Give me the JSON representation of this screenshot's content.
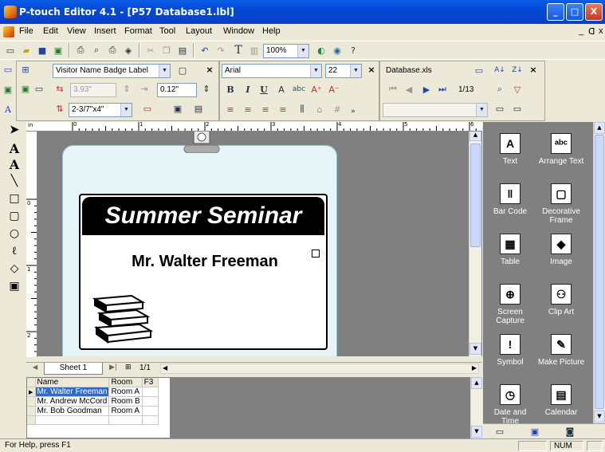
{
  "window": {
    "title": "P-touch Editor 4.1 - [P57 Database1.lbl]",
    "min": "_",
    "max": "□",
    "close": "X"
  },
  "menu": [
    "File",
    "Edit",
    "View",
    "Insert",
    "Format",
    "Tool",
    "Layout",
    "Window",
    "Help"
  ],
  "menu_right": {
    "minimize": "_",
    "restore": "ᗡ",
    "close": "x"
  },
  "toolbar": {
    "zoom": "100%"
  },
  "property_bar": {
    "label_type": "Visitor Name Badge Label",
    "width_value": "3.93\"",
    "margin_value": "0.12\"",
    "paper_size": "2-3/7\"x4\"",
    "font_name": "Arial",
    "font_size": "22",
    "database_file": "Database.xls",
    "record_counter": "1/13",
    "bold": "B",
    "italic": "I",
    "underline": "U"
  },
  "ruler": {
    "unit": "in",
    "ticks": [
      "0",
      "1",
      "2",
      "3",
      "4",
      "5",
      "6"
    ]
  },
  "label": {
    "title": "Summer Seminar",
    "name": "Mr. Walter Freeman"
  },
  "sheet": {
    "tab": "Sheet 1",
    "page": "1/1"
  },
  "database": {
    "columns": [
      "Name",
      "Room",
      "F3"
    ],
    "rows": [
      {
        "name": "Mr. Walter Freeman",
        "room": "Room A",
        "selected": true
      },
      {
        "name": "Mr. Andrew McCord",
        "room": "Room B",
        "selected": false
      },
      {
        "name": "Mr. Bob Goodman",
        "room": "Room A",
        "selected": false
      }
    ]
  },
  "right_panel": {
    "items": [
      {
        "label": "Text",
        "icon": "text-icon",
        "glyph": "A"
      },
      {
        "label": "Arrange Text",
        "icon": "arrange-text-icon",
        "glyph": "ᵃᵇᶜ"
      },
      {
        "label": "Bar Code",
        "icon": "barcode-icon",
        "glyph": "‖"
      },
      {
        "label": "Decorative Frame",
        "icon": "frame-icon",
        "glyph": "▢"
      },
      {
        "label": "Table",
        "icon": "table-icon",
        "glyph": "▦"
      },
      {
        "label": "Image",
        "icon": "image-icon",
        "glyph": "◆"
      },
      {
        "label": "Screen Capture",
        "icon": "screen-capture-icon",
        "glyph": "⊕"
      },
      {
        "label": "Clip Art",
        "icon": "clip-art-icon",
        "glyph": "⚇"
      },
      {
        "label": "Symbol",
        "icon": "symbol-icon",
        "glyph": "!"
      },
      {
        "label": "Make Picture",
        "icon": "make-picture-icon",
        "glyph": "✎"
      },
      {
        "label": "Date and Time",
        "icon": "clock-icon",
        "glyph": "◷"
      },
      {
        "label": "Calendar",
        "icon": "calendar-icon",
        "glyph": "▤"
      }
    ]
  },
  "status": {
    "help": "For Help, press F1",
    "num": "NUM"
  },
  "colors": {
    "title_blue": "#0447d6",
    "canvas_gray": "#808080",
    "label_tint": "#e6f4f7",
    "selection": "#316ac5"
  }
}
